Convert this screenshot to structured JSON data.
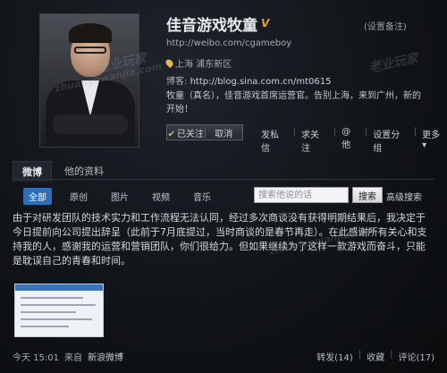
{
  "profile": {
    "name": "佳音游戏牧童",
    "verified_mark": "V",
    "remark_link": "(设置备注)",
    "weibo_url": "http://weibo.com/cgameboy",
    "location": "上海 浦东新区",
    "blog_label": "博客:",
    "blog_url": "http://blog.sina.com.cn/mt0615",
    "bio": "牧童（真名），佳音游戏首席运营官。告别上海，来到广州，新的开始！",
    "follow_label": "已关注",
    "unfollow_label": "取消",
    "actions": [
      "发私信",
      "求关注",
      "@他",
      "设置分组",
      "更多"
    ]
  },
  "tabs": [
    {
      "label": "微博",
      "active": true
    },
    {
      "label": "他的资料",
      "active": false
    }
  ],
  "filters": [
    {
      "label": "全部",
      "active": true
    },
    {
      "label": "原创",
      "active": false
    },
    {
      "label": "图片",
      "active": false
    },
    {
      "label": "视频",
      "active": false
    },
    {
      "label": "音乐",
      "active": false
    }
  ],
  "search": {
    "placeholder": "搜索他说的话",
    "button_label": "搜索",
    "advanced_label": "高级搜索"
  },
  "post": {
    "text": "由于对研发团队的技术实力和工作流程无法认同，经过多次商谈没有获得明期结果后，我决定于今日提前向公司提出辞呈（此前于7月底提过，当时商谈的是春节再走）。在此感谢所有关心和支持我的人，感谢我的运营和营销团队，你们很给力。但如果继续为了这样一款游戏而奋斗，只能是耽误自己的青春和时间。",
    "time": "今天 15:01",
    "source_prefix": "来自",
    "source": "新浪微博",
    "repost": "转发(14)",
    "favorite": "收藏",
    "comment": "评论(17)"
  },
  "watermarks": [
    "老业玩家",
    "zhuanyewanjia.com",
    "老业玩家",
    "zhuanyewanjia.com"
  ],
  "colors": {
    "accent": "#2f6fb5",
    "verified": "#e6a21a",
    "background": "#111418"
  }
}
